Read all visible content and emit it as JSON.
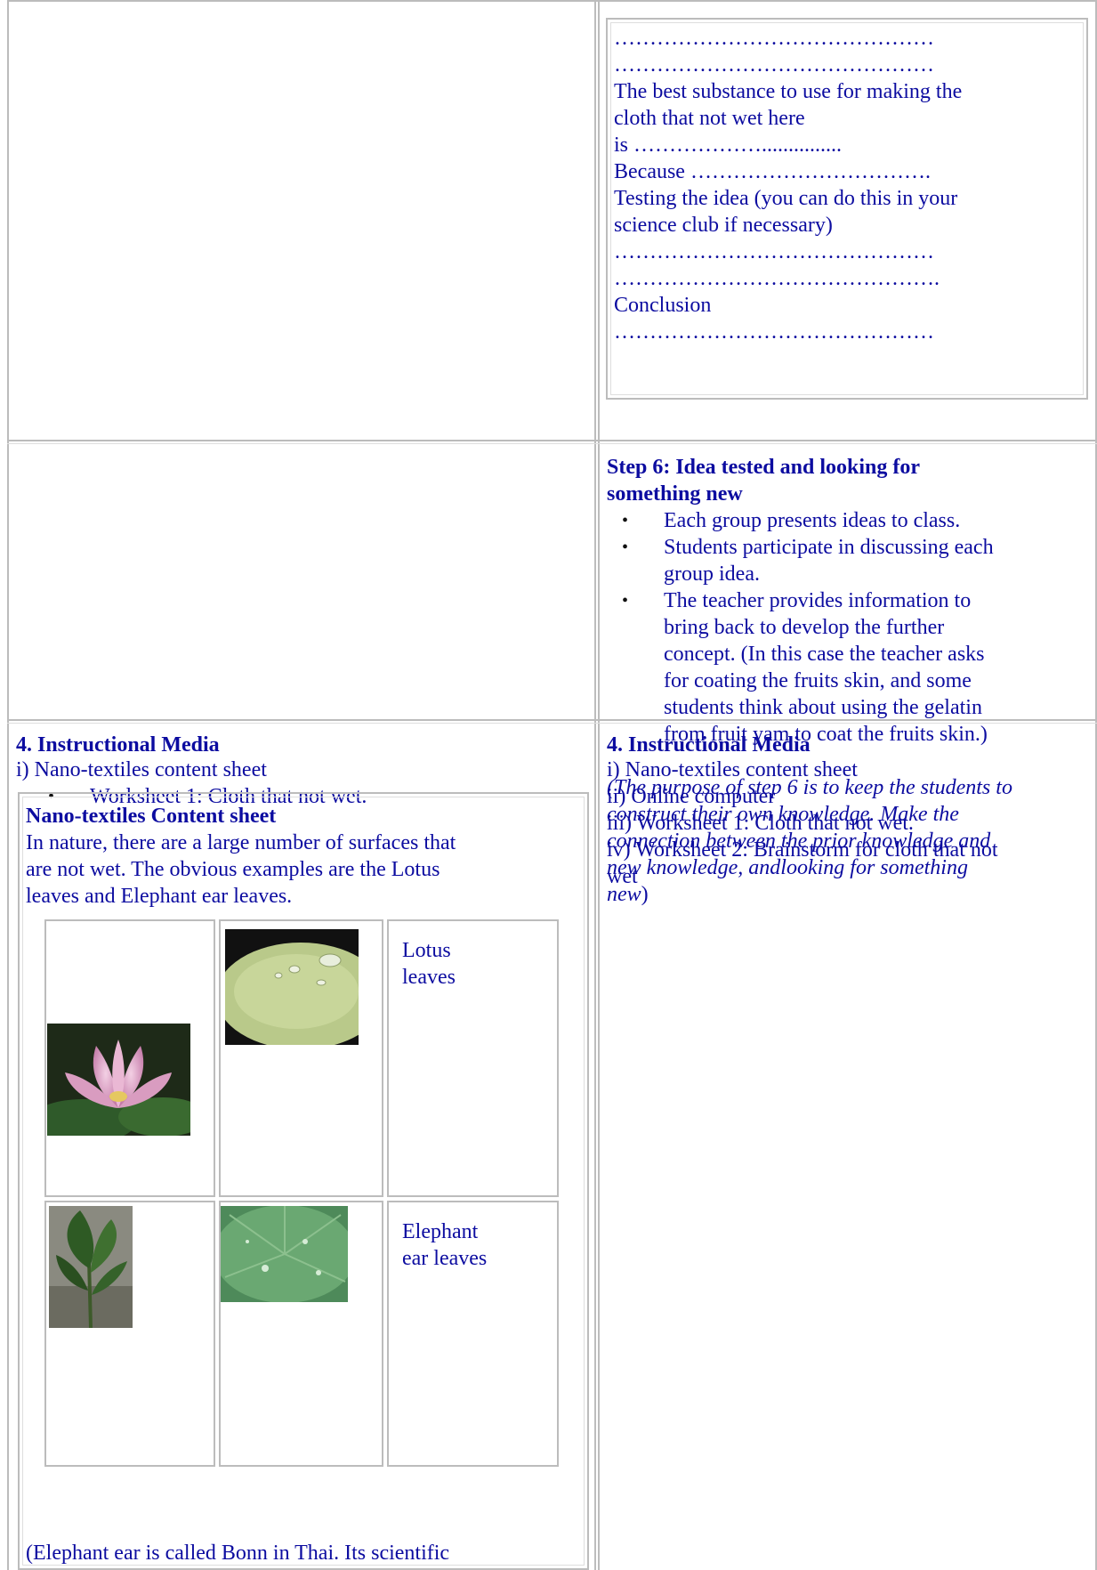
{
  "worksheet_box": {
    "dots_1": "………………………………………",
    "dots_2": "………………………………………",
    "best_substance_1": "The best substance to use for making the",
    "best_substance_2": "cloth that not wet here",
    "is_line": "is ………………...............",
    "because_line": "Because …………………………….",
    "testing_1": "Testing the idea (you can do this in your",
    "testing_2": "science club if necessary)",
    "dots_3": "………………………………………",
    "dots_4": "……………………………………….",
    "conclusion": "Conclusion",
    "dots_5": "………………………………………"
  },
  "step6": {
    "title_1": "Step 6: Idea tested and looking for",
    "title_2": "something new",
    "bullets": [
      [
        "Each group presents ideas to class."
      ],
      [
        "Students participate in discussing each",
        "group idea."
      ],
      [
        "The teacher provides information to",
        "bring back to develop the further",
        "concept. (In this case the teacher asks",
        "for coating the fruits skin, and some",
        "students think about using the gelatin",
        "from fruit yam to coat the fruits skin.)"
      ]
    ],
    "purpose_1": "(The purpose of step 6 is to keep the students to",
    "purpose_2": "construct their own knowledge. Make the",
    "purpose_3": "connection between the prior knowledge and",
    "purpose_4": "new knowledge, andlooking for something",
    "purpose_5": "new",
    "purpose_close": ")"
  },
  "left_media": {
    "heading": "4.  Instructional Media",
    "item_1": "i) Nano-textiles content sheet",
    "bullet": "Worksheet 1:  Cloth that not wet."
  },
  "content_sheet": {
    "title": "Nano-textiles Content sheet",
    "text_1": "In nature, there are a large number of surfaces that",
    "text_2": "are not wet.  The obvious examples are the Lotus",
    "text_3": "leaves and Elephant ear leaves.",
    "row1_label_1": "Lotus",
    "row1_label_2": "leaves",
    "row2_label_1": "Elephant",
    "row2_label_2": "ear leaves",
    "footer": "(Elephant ear is called Bonn in Thai. Its scientific"
  },
  "right_media": {
    "heading": "4.  Instructional Media",
    "items": [
      "i) Nano-textiles content sheet",
      "ii) Online computer",
      "iii) Worksheet 1:  Cloth that not wet.",
      "iv) Worksheet 2: Brainstorm for cloth that not",
      "wet"
    ]
  },
  "colors": {
    "text": "#0c0ca0",
    "border": "#bcbcbc"
  }
}
